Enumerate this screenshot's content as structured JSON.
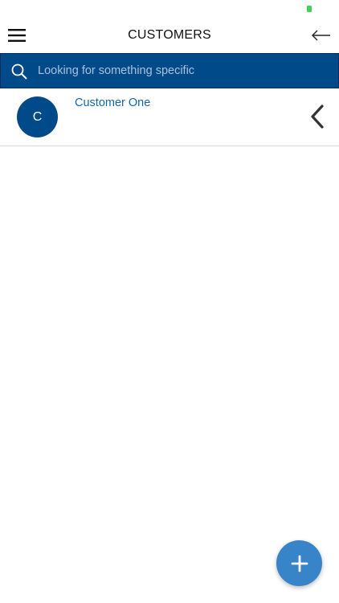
{
  "header": {
    "title": "CUSTOMERS",
    "menu_icon": "hamburger-menu-icon",
    "back_icon": "arrow-left-icon"
  },
  "search": {
    "placeholder": "Looking for something specific",
    "value": "",
    "icon": "search-icon"
  },
  "customers": [
    {
      "initial": "C",
      "name": "Customer One"
    }
  ],
  "fab": {
    "icon": "plus-icon"
  },
  "colors": {
    "primary": "#004a89",
    "link": "#1565a8",
    "fab": "#3784c8",
    "battery": "#43d05a"
  }
}
